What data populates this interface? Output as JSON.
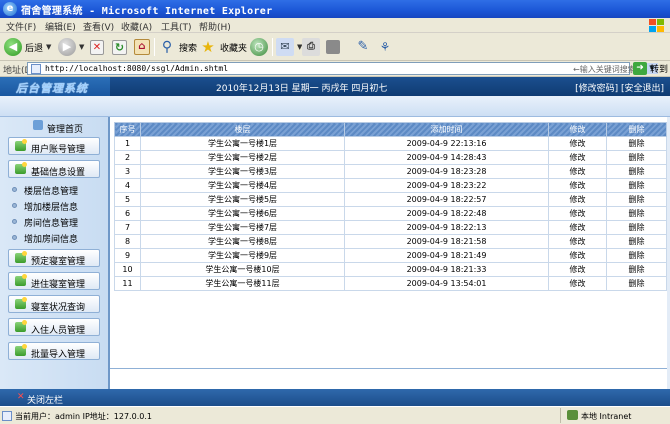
{
  "window": {
    "title": "宿舍管理系统 - Microsoft Internet Explorer"
  },
  "menu": [
    "文件(F)",
    "编辑(E)",
    "查看(V)",
    "收藏(A)",
    "工具(T)",
    "帮助(H)"
  ],
  "toolbar": {
    "back": "后退",
    "search": "搜索",
    "favorites": "收藏夹"
  },
  "address": {
    "label": "地址(D)",
    "url": "http://localhost:8080/ssgl/Admin.shtml",
    "search_placeholder": "←输入关键词搜索",
    "go": "转到"
  },
  "app": {
    "logo": "后台管理系统",
    "date": "2010年12月13日 星期一 丙戌年 四月初七",
    "change_password": "[修改密码]",
    "logout": "[安全退出]"
  },
  "sidebar": {
    "home": "管理首页",
    "buttons_top": [
      "用户账号管理",
      "基础信息设置"
    ],
    "subitems": [
      "楼层信息管理",
      "增加楼层信息",
      "房间信息管理",
      "增加房间信息"
    ],
    "buttons_bottom": [
      "预定寝室管理",
      "进住寝室管理",
      "寝室状况查询",
      "入住人员管理",
      "批量导入管理"
    ]
  },
  "table": {
    "headers": [
      "序号",
      "楼层",
      "添加时间",
      "修改",
      "删除"
    ],
    "rows": [
      [
        "1",
        "学生公寓一号楼1层",
        "2009-04-9 22:13:16",
        "修改",
        "删除"
      ],
      [
        "2",
        "学生公寓一号楼2层",
        "2009-04-9 14:28:43",
        "修改",
        "删除"
      ],
      [
        "3",
        "学生公寓一号楼3层",
        "2009-04-9 18:23:28",
        "修改",
        "删除"
      ],
      [
        "4",
        "学生公寓一号楼4层",
        "2009-04-9 18:23:22",
        "修改",
        "删除"
      ],
      [
        "5",
        "学生公寓一号楼5层",
        "2009-04-9 18:22:57",
        "修改",
        "删除"
      ],
      [
        "6",
        "学生公寓一号楼6层",
        "2009-04-9 18:22:48",
        "修改",
        "删除"
      ],
      [
        "7",
        "学生公寓一号楼7层",
        "2009-04-9 18:22:13",
        "修改",
        "删除"
      ],
      [
        "8",
        "学生公寓一号楼8层",
        "2009-04-9 18:21:58",
        "修改",
        "删除"
      ],
      [
        "9",
        "学生公寓一号楼9层",
        "2009-04-9 18:21:49",
        "修改",
        "删除"
      ],
      [
        "10",
        "学生公寓一号楼10层",
        "2009-04-9 18:21:33",
        "修改",
        "删除"
      ],
      [
        "11",
        "学生公寓一号楼11层",
        "2009-04-9 13:54:01",
        "修改",
        "删除"
      ]
    ]
  },
  "footer": {
    "close_sidebar": "关闭左栏"
  },
  "status": {
    "text": "当前用户：admin  IP地址：127.0.0.1",
    "zone": "本地 Intranet"
  },
  "colors": {
    "header": "#1b4f8f",
    "sidebar": "#dae8f7",
    "table_header": "#5d8ac4"
  }
}
